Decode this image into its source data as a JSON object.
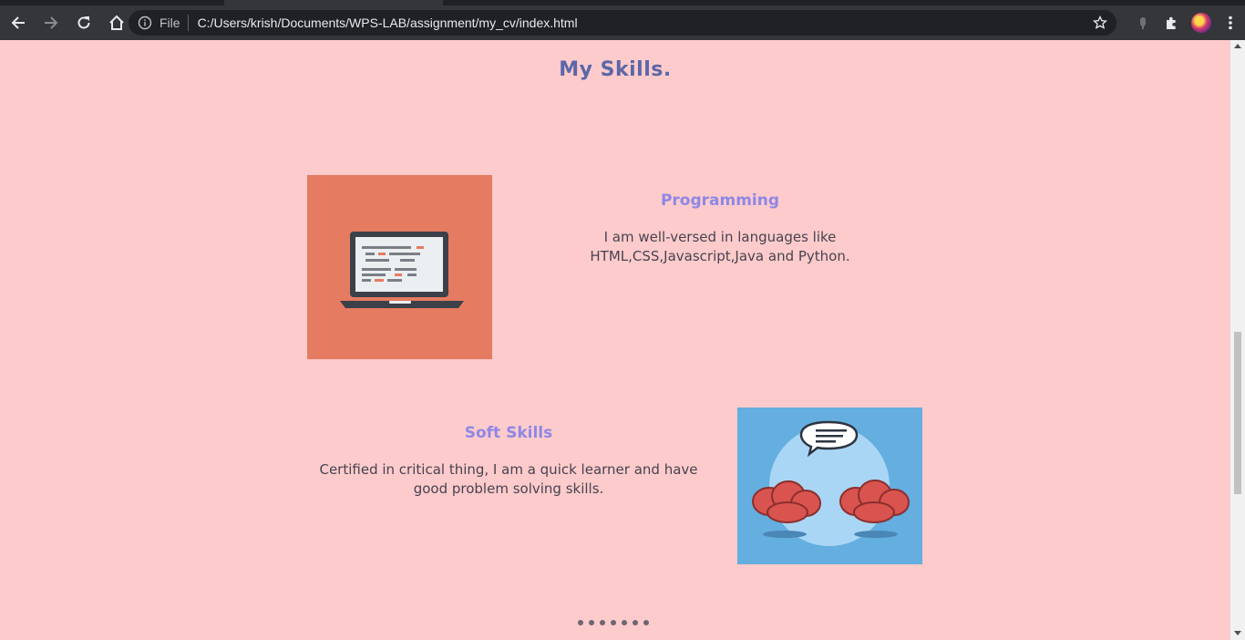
{
  "browser": {
    "scheme_label": "File",
    "url": "C:/Users/krish/Documents/WPS-LAB/assignment/my_cv/index.html"
  },
  "page": {
    "title": "My Skills.",
    "skills": [
      {
        "heading": "Programming",
        "text": "I am well-versed in languages like HTML,CSS,Javascript,Java and Python.",
        "image": "laptop-illustration"
      },
      {
        "heading": "Soft Skills",
        "text": "Certified in critical thing, I am a quick learner and have good problem solving skills.",
        "image": "brains-speech-bubble-illustration"
      }
    ],
    "carousel_dots": 7
  },
  "colors": {
    "background": "#fdcbcb",
    "title": "#5a67a8",
    "heading": "#8f87e6",
    "programming_image_bg": "#e57b61",
    "soft_image_bg": "#64aee0"
  }
}
